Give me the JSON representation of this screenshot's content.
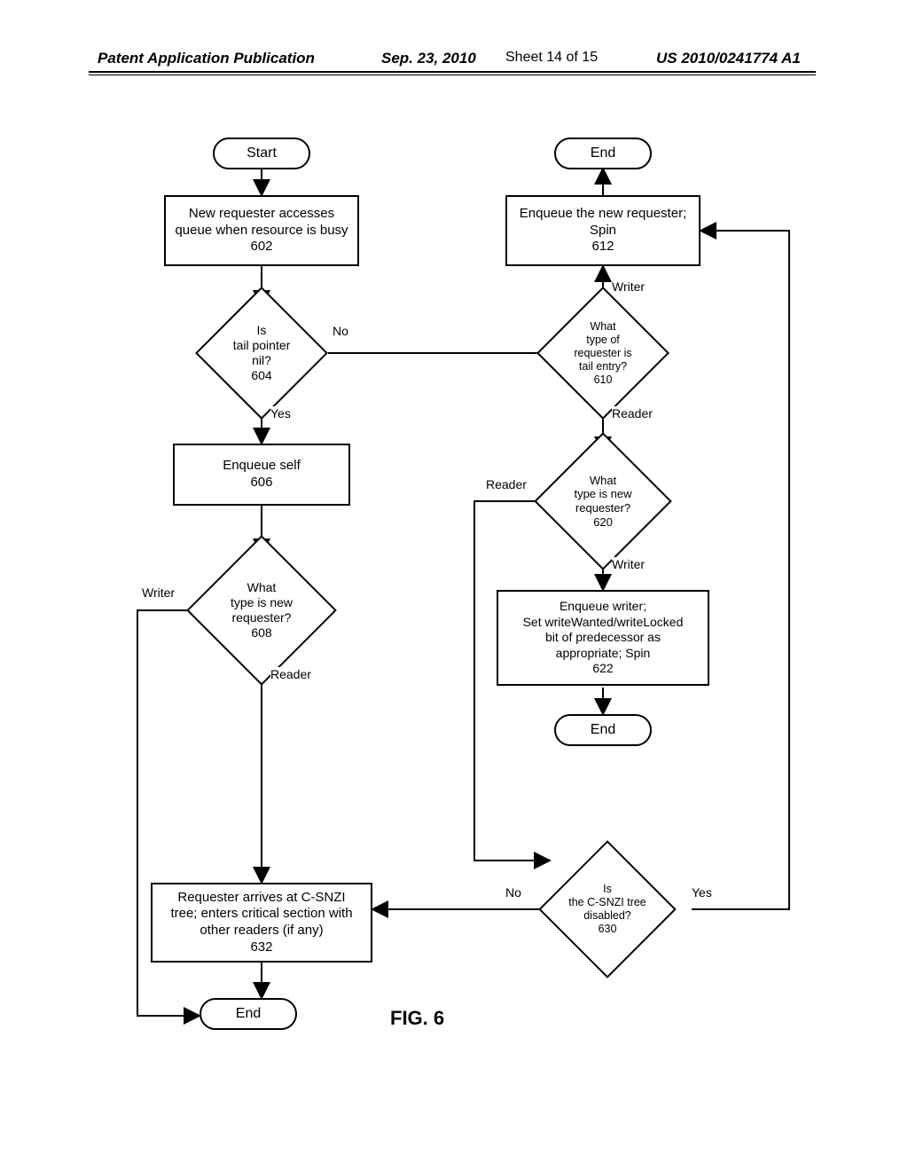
{
  "header": {
    "left": "Patent Application Publication",
    "date": "Sep. 23, 2010",
    "sheet": "Sheet 14 of 15",
    "pubno": "US 2010/0241774 A1"
  },
  "figure_label": "FIG. 6",
  "nodes": {
    "start": "Start",
    "n602": "New requester accesses queue when resource is busy\n602",
    "n604": "Is\ntail pointer nil?\n604",
    "n606": "Enqueue self\n606",
    "n608": "What\ntype is new\nrequester?\n608",
    "n610": "What\ntype of requester is\ntail entry?\n610",
    "n612": "Enqueue the new requester;\nSpin\n612",
    "end_top": "End",
    "n620": "What\ntype is new\nrequester?\n620",
    "n622": "Enqueue writer;\nSet writeWanted/writeLocked\nbit of predecessor as\nappropriate; Spin\n622",
    "end_mid": "End",
    "n630": "Is\nthe C-SNZI tree\ndisabled?\n630",
    "n632": "Requester arrives at C-SNZI\ntree; enters critical section with\nother readers (if any)\n632",
    "end_bot": "End"
  },
  "edges": {
    "n604_no": "No",
    "n604_yes": "Yes",
    "n608_writer": "Writer",
    "n608_reader": "Reader",
    "n610_writer": "Writer",
    "n610_reader": "Reader",
    "n620_reader": "Reader",
    "n620_writer": "Writer",
    "n630_no": "No",
    "n630_yes": "Yes"
  }
}
